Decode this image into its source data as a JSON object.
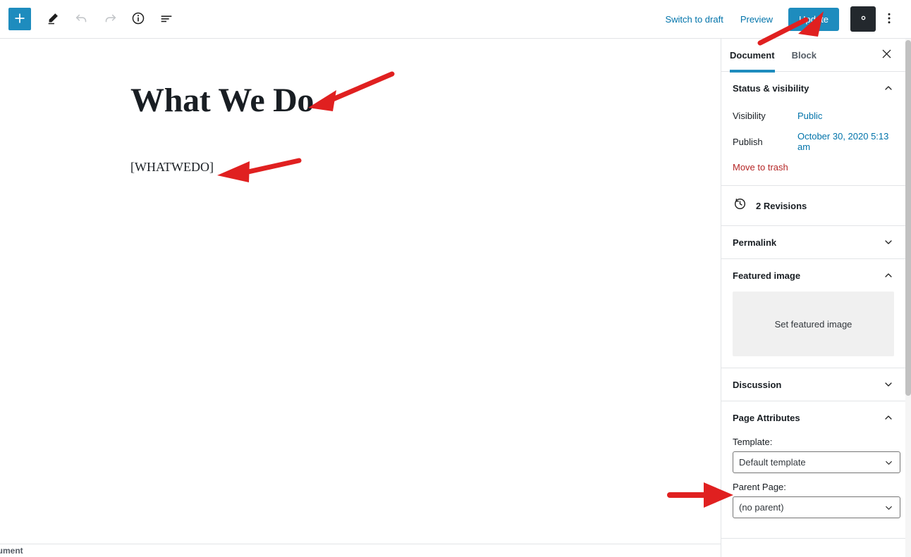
{
  "toolbar": {
    "add_block_label": "+",
    "icons": [
      {
        "name": "add-block-icon",
        "glyph": "+"
      },
      {
        "name": "edit-pencil-icon",
        "glyph": "pencil"
      },
      {
        "name": "undo-icon",
        "glyph": "undo"
      },
      {
        "name": "redo-icon",
        "glyph": "redo"
      },
      {
        "name": "info-icon",
        "glyph": "info"
      },
      {
        "name": "list-view-icon",
        "glyph": "list"
      }
    ],
    "switch_to_draft_label": "Switch to draft",
    "preview_label": "Preview",
    "update_label": "Update",
    "settings_icon": "gear-icon",
    "more_menu_icon": "kebab-menu-icon"
  },
  "editor": {
    "post_title": "What We Do",
    "post_body": "[WHATWEDO]",
    "breadcrumb": "Document"
  },
  "sidebar": {
    "tabs": [
      {
        "label": "Document",
        "active": true
      },
      {
        "label": "Block",
        "active": false
      }
    ],
    "close_icon": "close-icon",
    "status_visibility": {
      "title": "Status & visibility",
      "expanded": true,
      "visibility_label": "Visibility",
      "visibility_value": "Public",
      "publish_label": "Publish",
      "publish_value": "October 30, 2020 5:13 am",
      "trash_label": "Move to trash"
    },
    "revisions": {
      "label": "2 Revisions",
      "icon": "revision-clock-icon"
    },
    "permalink": {
      "title": "Permalink",
      "expanded": false
    },
    "featured_image": {
      "title": "Featured image",
      "expanded": true,
      "placeholder_label": "Set featured image"
    },
    "discussion": {
      "title": "Discussion",
      "expanded": false
    },
    "page_attributes": {
      "title": "Page Attributes",
      "expanded": true,
      "template_label": "Template:",
      "template_value": "Default template",
      "parent_label": "Parent Page:",
      "parent_value": "(no parent)"
    }
  },
  "colors": {
    "accent_blue": "#1e8cbe",
    "link_blue": "#0073aa",
    "trash_red": "#b52727",
    "annotation_red": "#e02020",
    "dark_button": "#23282d"
  }
}
